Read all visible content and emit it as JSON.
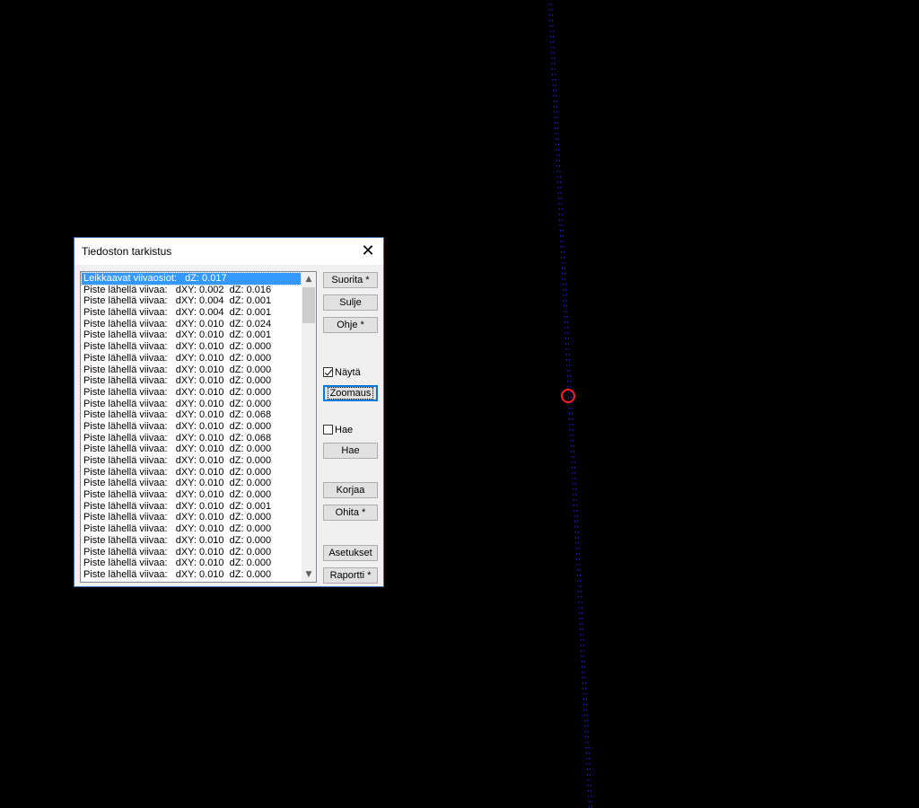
{
  "dialog": {
    "title": "Tiedoston tarkistus",
    "close_label": "✕"
  },
  "list": {
    "items": [
      "Leikkaavat viivaosiot:   dZ: 0.017",
      "Piste lähellä viivaa:   dXY: 0.002  dZ: 0.016",
      "Piste lähellä viivaa:   dXY: 0.004  dZ: 0.001",
      "Piste lähellä viivaa:   dXY: 0.004  dZ: 0.001",
      "Piste lähellä viivaa:   dXY: 0.010  dZ: 0.024",
      "Piste lähellä viivaa:   dXY: 0.010  dZ: 0.001",
      "Piste lähellä viivaa:   dXY: 0.010  dZ: 0.000",
      "Piste lähellä viivaa:   dXY: 0.010  dZ: 0.000",
      "Piste lähellä viivaa:   dXY: 0.010  dZ: 0.000",
      "Piste lähellä viivaa:   dXY: 0.010  dZ: 0.000",
      "Piste lähellä viivaa:   dXY: 0.010  dZ: 0.000",
      "Piste lähellä viivaa:   dXY: 0.010  dZ: 0.000",
      "Piste lähellä viivaa:   dXY: 0.010  dZ: 0.068",
      "Piste lähellä viivaa:   dXY: 0.010  dZ: 0.000",
      "Piste lähellä viivaa:   dXY: 0.010  dZ: 0.068",
      "Piste lähellä viivaa:   dXY: 0.010  dZ: 0.000",
      "Piste lähellä viivaa:   dXY: 0.010  dZ: 0.000",
      "Piste lähellä viivaa:   dXY: 0.010  dZ: 0.000",
      "Piste lähellä viivaa:   dXY: 0.010  dZ: 0.000",
      "Piste lähellä viivaa:   dXY: 0.010  dZ: 0.000",
      "Piste lähellä viivaa:   dXY: 0.010  dZ: 0.001",
      "Piste lähellä viivaa:   dXY: 0.010  dZ: 0.000",
      "Piste lähellä viivaa:   dXY: 0.010  dZ: 0.000",
      "Piste lähellä viivaa:   dXY: 0.010  dZ: 0.000",
      "Piste lähellä viivaa:   dXY: 0.010  dZ: 0.000",
      "Piste lähellä viivaa:   dXY: 0.010  dZ: 0.000",
      "Piste lähellä viivaa:   dXY: 0.010  dZ: 0.000"
    ],
    "selected_index": 0,
    "scroll_up_icon": "▲",
    "scroll_down_icon": "▼"
  },
  "buttons": {
    "suorita": "Suorita *",
    "sulje": "Sulje",
    "ohje": "Ohje *",
    "zoomaus": "Zoomaus",
    "hae": "Hae",
    "korjaa": "Korjaa",
    "ohita": "Ohita *",
    "asetukset": "Asetukset",
    "raportti": "Raportti *"
  },
  "checkboxes": {
    "nayta_label": "Näytä",
    "nayta_checked": true,
    "hae_label": "Hae",
    "hae_checked": false
  },
  "colors": {
    "background": "#000000",
    "line_dots": "#2a2aff",
    "marker": "#ff2020",
    "selection": "#3399ff"
  }
}
